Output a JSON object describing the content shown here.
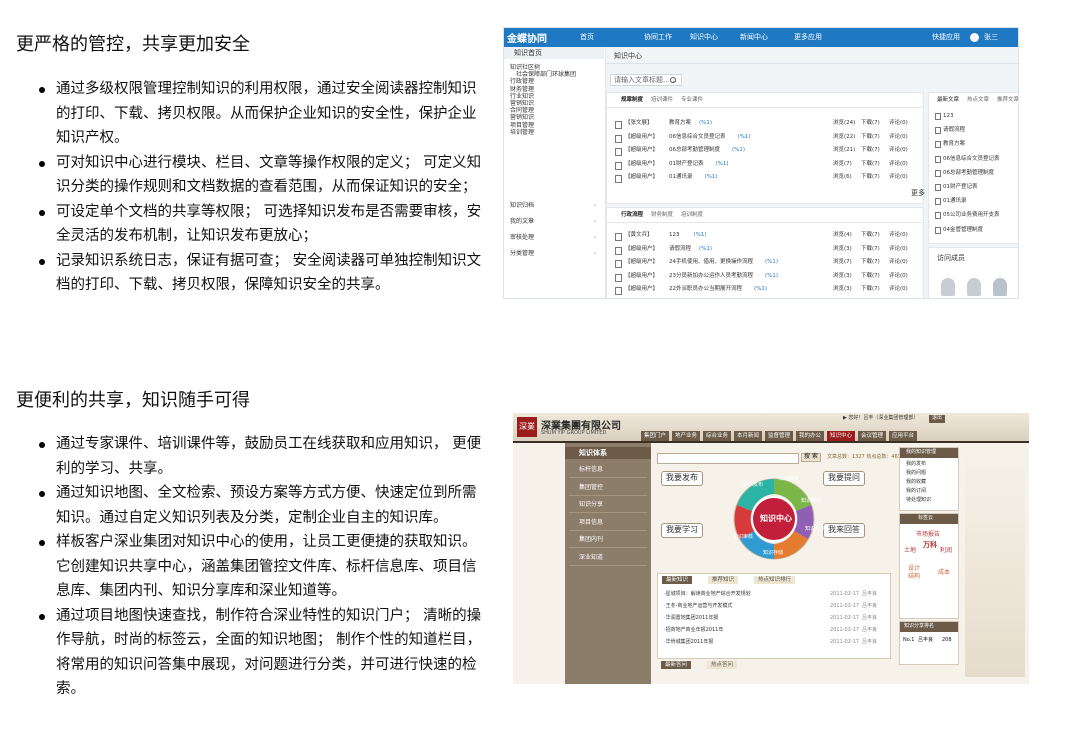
{
  "section1": {
    "title": "更严格的管控，共享更加安全",
    "bullets": [
      "通过多级权限管理控制知识的利用权限，通过安全阅读器控制知识的打印、下载、拷贝权限。从而保护企业知识的安全性，保护企业知识产权。",
      "可对知识中心进行模块、栏目、文章等操作权限的定义； 可定义知识分类的操作规则和文档数据的查看范围，从而保证知识的安全；",
      "可设定单个文档的共享等权限； 可选择知识发布是否需要审核，安全灵活的发布机制，让知识发布更放心；",
      "记录知识系统日志，保证有据可查； 安全阅读器可单独控制知识文档的打印、下载、拷贝权限，保障知识安全的共享。"
    ]
  },
  "section2": {
    "title": "更便利的共享，知识随手可得",
    "bullets": [
      "通过专家课件、培训课件等，鼓励员工在线获取和应用知识， 更便利的学习、共享。",
      "通过知识地图、全文检索、预设方案等方式方便、快速定位到所需知识。通过自定义知识列表及分类，定制企业自主的知识库。",
      "样板客户深业集团对知识中心的使用，让员工更便捷的获取知识。它创建知识共享中心，涵盖集团管控文件库、标杆信息库、项目信息库、集团内刊、知识分享库和深业知道等。",
      "通过项目地图快速查找，制作符合深业特性的知识门户； 清晰的操作导航，时尚的标签云，全面的知识地图； 制作个性的知道栏目，将常用的知识问答集中展现，对问题进行分类，并可进行快速的检索。"
    ]
  },
  "shot1": {
    "logo": "金蝶协同",
    "nav": [
      "首页",
      "协同工作",
      "知识中心",
      "新闻中心",
      "更多应用"
    ],
    "user_area": [
      "快捷应用",
      "张三"
    ],
    "sidebar_head": "知识首页",
    "tree": [
      "知识社区树",
      "社会保障部门环球集团",
      "行政管理",
      "财务管理",
      "行业知识",
      "营销知识",
      "合同管理",
      "营销知识",
      "项目管理",
      "培训管理"
    ],
    "sidebar_menu": [
      "知识归档",
      "我的文章",
      "审核处理",
      "分类管理"
    ],
    "crumb": "知识中心",
    "search_placeholder": "请输入文章标题……",
    "tabs1": [
      "规章制度",
      "培训课件",
      "专业课件"
    ],
    "tabs2": [
      "行政流程",
      "财务制度",
      "培训制度"
    ],
    "rows1": [
      {
        "tag": "【张文展】",
        "title": "教育方案",
        "count": "(%1)",
        "stats": [
          "浏览(24)",
          "下载(7)",
          "评论(0)"
        ]
      },
      {
        "tag": "【超级用户】",
        "title": "06信息综合文员登记表",
        "count": "(%1)",
        "stats": [
          "浏览(22)",
          "下载(7)",
          "评论(0)"
        ]
      },
      {
        "tag": "【超级用户】",
        "title": "06总部考勤管理制度",
        "count": "(%1)",
        "stats": [
          "浏览(21)",
          "下载(7)",
          "评论(0)"
        ]
      },
      {
        "tag": "【超级用户】",
        "title": "01财产登记表",
        "count": "(%1)",
        "stats": [
          "浏览(7)",
          "下载(7)",
          "评论(0)"
        ]
      },
      {
        "tag": "【超级用户】",
        "title": "01通讯录",
        "count": "(%1)",
        "stats": [
          "浏览(6)",
          "下载(7)",
          "评论(0)"
        ]
      }
    ],
    "more": "更多",
    "rows2": [
      {
        "tag": "【黄文兵】",
        "title": "123",
        "count": "(%1)",
        "stats": [
          "浏览(4)",
          "下载(7)",
          "评论(0)"
        ]
      },
      {
        "tag": "【超级用户】",
        "title": "请假流程",
        "count": "(%1)",
        "stats": [
          "浏览(3)",
          "下载(7)",
          "评论(0)"
        ]
      },
      {
        "tag": "【超级用户】",
        "title": "24手机使用、借用、更换操作流程",
        "count": "(%1)",
        "stats": [
          "浏览(7)",
          "下载(7)",
          "评论(0)"
        ]
      },
      {
        "tag": "【超级用户】",
        "title": "23分员新加办公运作人员考勤流程",
        "count": "(%1)",
        "stats": [
          "浏览(3)",
          "下载(7)",
          "评论(0)"
        ]
      },
      {
        "tag": "【超级用户】",
        "title": "22外派职员办公当期展开流程",
        "count": "(%1)",
        "stats": [
          "浏览(3)",
          "下载(7)",
          "评论(0)"
        ]
      }
    ],
    "right_tabs": [
      "最新文章",
      "热点文章",
      "推荐文章"
    ],
    "right_list": [
      "123",
      "请假流程",
      "教育方案",
      "06信息综合文员登记表",
      "06总部考勤管理制度",
      "01财产登记表",
      "01通讯录",
      "05公司业务费用开支表",
      "04金管管理制度"
    ],
    "visitors_title": "访问成员"
  },
  "shot2": {
    "logo_mark": "深業",
    "company": "深業集團有限公司",
    "company_en": "SHUM YIP GROUP LIMITED",
    "top_info": "▶ 您好！吕丰（深业集团管理部）",
    "top_btn": "退出",
    "nav": [
      "集团门户",
      "地产业务",
      "综合业务",
      "本月新闻",
      "监督管理",
      "我的办公",
      "知识中心",
      "会议管理",
      "应用平台"
    ],
    "left_title": "知识体系",
    "left_menu": [
      "标杆信息",
      "集团管控",
      "知识分享",
      "项目信息",
      "集团内刊",
      "深业知道"
    ],
    "search_btn": "搜 索",
    "search_stats": "文章总数：1327  热点总数：463",
    "actions": [
      "我要发布",
      "我要提问",
      "我要学习",
      "我来回答"
    ],
    "center": "知识中心",
    "ring": [
      "知识获取",
      "知识发布",
      "知识使用",
      "知识分享",
      "知识存储",
      "知识审核"
    ],
    "tabs": [
      "最新知识",
      "推荐知识",
      "热点知识排行"
    ],
    "list": [
      {
        "text": "·星城项目：解读商业地产综合开发规划",
        "date": "2011-02-17",
        "author": "吕丰良"
      },
      {
        "text": "·王冬-商业地产运营与开发模式",
        "date": "2011-02-17",
        "author": "吕丰良"
      },
      {
        "text": "·华润置地集团2011年报",
        "date": "2011-02-17",
        "author": "吕丰良"
      },
      {
        "text": "·招商地产商业年报2011年",
        "date": "2011-02-17",
        "author": "吕丰良"
      },
      {
        "text": "·华侨城集团2011年报",
        "date": "2011-02-17",
        "author": "吕丰良"
      }
    ],
    "bottom_tabs": [
      "最新答问",
      "热点答问"
    ],
    "right_box1_title": "我的知识管理",
    "right_box1": [
      "我的发布",
      "我的问题",
      "我的收藏",
      "我的订阅",
      "待处理知识"
    ],
    "right_box2_title": "标签云",
    "tag_cloud": [
      "市场报告",
      "土地",
      "万科",
      "利润",
      "成本",
      "设计",
      "结构"
    ],
    "right_box3_title": "知识分享排名",
    "rank": [
      "No.1",
      "吕丰良",
      "208"
    ]
  }
}
